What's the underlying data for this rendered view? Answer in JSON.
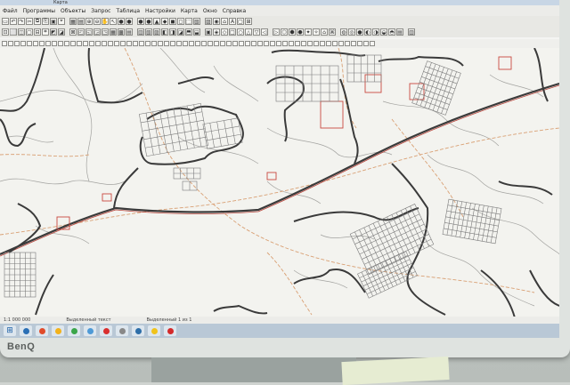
{
  "window": {
    "title": "Карта"
  },
  "menu": [
    "Файл",
    "Программы",
    "Объекты",
    "Запрос",
    "Таблица",
    "Настройки",
    "Карта",
    "Окно",
    "Справка"
  ],
  "toolbar1_symbols": [
    "▭",
    "↶",
    "↷",
    "✂",
    "⧉",
    "⎘",
    "▣",
    "⌖",
    "▦",
    "▤",
    "⊕",
    "⊖",
    "✋",
    "↖",
    "●",
    "●",
    "●",
    "●",
    "▲",
    "◆",
    "◼",
    "◻",
    "⬚",
    "▧",
    "▨",
    "◉",
    "⌂",
    "A",
    "▢",
    "⊞"
  ],
  "toolbar2_symbols": [
    "⊡",
    "⬜",
    "◫",
    "▢",
    "⊟",
    "⌗",
    "◩",
    "◪",
    "⊠",
    "◰",
    "◱",
    "◲",
    "◳",
    "▦",
    "▩",
    "▤",
    "▥",
    "▧",
    "▨",
    "◧",
    "◨",
    "◪",
    "⬒",
    "⬓",
    "▣",
    "◈",
    "◇",
    "□",
    "○",
    "△",
    "▽",
    "◁",
    "▷",
    "⬡",
    "⬢",
    "⬣",
    "✦",
    "✧",
    "⌂",
    "⌘",
    "◍",
    "◎",
    "●",
    "◐",
    "◑",
    "◒",
    "◓",
    "▤",
    "▥"
  ],
  "statusbar": {
    "left": "1:1 000 000",
    "middle": "Выделенный текст",
    "right": "Выделенный 1 из 1"
  },
  "taskbar": {
    "colors": [
      "#2a6fb5",
      "#e04b2a",
      "#f2b21b",
      "#3aa54a",
      "#4e9ad6",
      "#d92f2f",
      "#888888",
      "#2d6ea8",
      "#f0c31c",
      "#d32a2a"
    ]
  },
  "monitor": {
    "brand": "BenQ"
  },
  "map": {
    "road_color": "#3a3a3a",
    "highway_color": "#b8433a",
    "dashed_road_color": "#d9a074",
    "plot_color": "#7b7b7b",
    "boundary_color": "#9a9a9a"
  }
}
